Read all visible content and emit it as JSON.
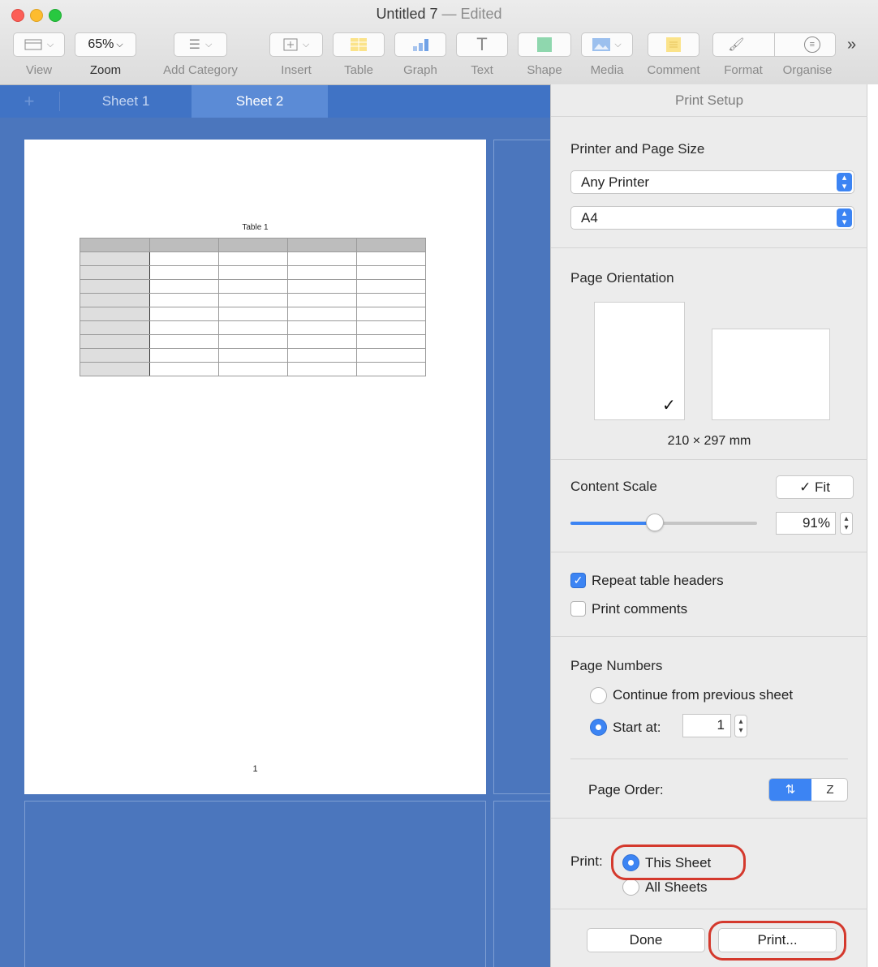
{
  "window": {
    "title": "Untitled 7",
    "status": "— Edited"
  },
  "toolbar": {
    "zoom_value": "65%",
    "labels": {
      "view": "View",
      "zoom": "Zoom",
      "add_category": "Add Category",
      "insert": "Insert",
      "table": "Table",
      "graph": "Graph",
      "text": "Text",
      "shape": "Shape",
      "media": "Media",
      "comment": "Comment",
      "format": "Format",
      "organise": "Organise"
    },
    "overflow": "»"
  },
  "tabs": [
    {
      "label": "Sheet 1"
    },
    {
      "label": "Sheet 2"
    }
  ],
  "page_preview": {
    "table_title": "Table 1",
    "page_number": "1",
    "rows": 10,
    "cols": 5
  },
  "print_setup": {
    "title": "Print Setup",
    "printer_section": "Printer and Page Size",
    "printer": "Any Printer",
    "paper_size": "A4",
    "orientation_section": "Page Orientation",
    "page_dimensions": "210 × 297 mm",
    "content_scale_label": "Content Scale",
    "fit_button": "✓ Fit",
    "scale_value": "91%",
    "scale_fraction": 0.45,
    "repeat_headers_label": "Repeat table headers",
    "repeat_headers_checked": true,
    "print_comments_label": "Print comments",
    "print_comments_checked": false,
    "page_numbers_section": "Page Numbers",
    "continue_label": "Continue from previous sheet",
    "start_at_label": "Start at:",
    "start_at_value": "1",
    "page_order_label": "Page Order:",
    "print_label": "Print:",
    "this_sheet_label": "This Sheet",
    "all_sheets_label": "All Sheets",
    "done_button": "Done",
    "print_button": "Print..."
  },
  "colors": {
    "accent": "#3c84f3",
    "canvas": "#4b76bd",
    "highlight": "#d4392d"
  }
}
